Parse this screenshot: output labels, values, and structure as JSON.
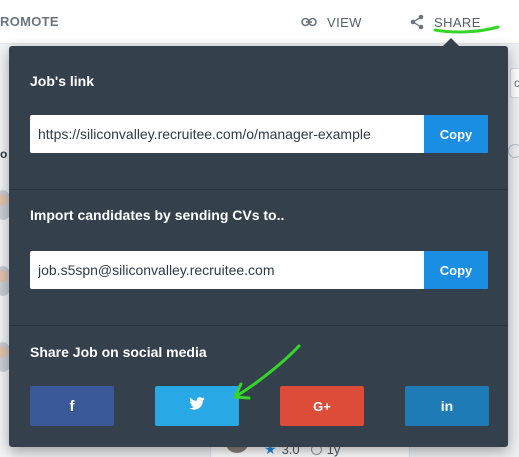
{
  "topbar": {
    "promote_label": "ROMOTE",
    "view_label": "VIEW",
    "share_label": "SHARE",
    "view_icon": "link-icon",
    "share_icon": "share-icon"
  },
  "background": {
    "left_fragment": "o",
    "right_tag_fragment": "c",
    "card_rating": "3.0",
    "card_age": "1y"
  },
  "popover": {
    "job_link": {
      "title": "Job's link",
      "value": "https://siliconvalley.recruitee.com/o/manager-example",
      "copy_label": "Copy"
    },
    "import_cv": {
      "title": "Import candidates by sending CVs to..",
      "value": "job.s5spn@siliconvalley.recruitee.com",
      "copy_label": "Copy"
    },
    "social": {
      "title": "Share Job on social media",
      "facebook": "f",
      "google": "G+",
      "linkedin": "in"
    }
  },
  "colors": {
    "popover_bg": "#34404c",
    "copy_button": "#1a8ee3",
    "facebook": "#3b5998",
    "twitter": "#28a9e5",
    "google": "#dd4b39",
    "linkedin": "#1f7bb6",
    "annotation": "#35d62b"
  }
}
